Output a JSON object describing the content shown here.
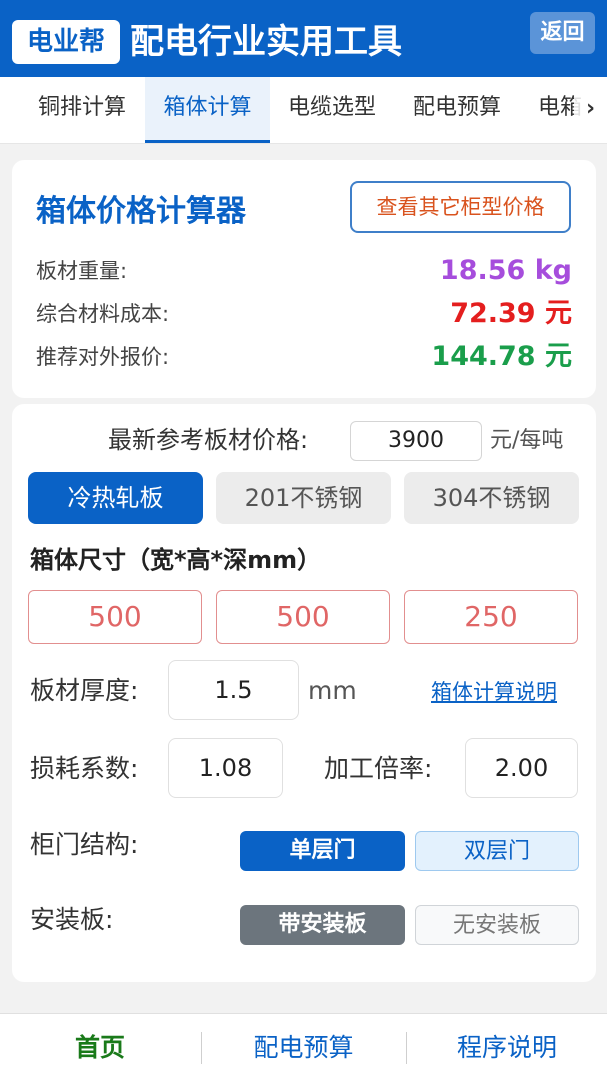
{
  "header": {
    "logo": "电业帮",
    "title": "配电行业实用工具",
    "back_label": "返回"
  },
  "tabs": [
    {
      "label": "铜排计算"
    },
    {
      "label": "箱体计算",
      "active": true
    },
    {
      "label": "电缆选型"
    },
    {
      "label": "配电预算"
    },
    {
      "label": "电箱"
    }
  ],
  "calculator": {
    "title": "箱体价格计算器",
    "other_price_button": "查看其它柜型价格",
    "results": [
      {
        "label": "板材重量:",
        "value": "18.56 kg",
        "color": "#a64ddc"
      },
      {
        "label": "综合材料成本:",
        "value": "72.39 元",
        "color": "#e41e1e"
      },
      {
        "label": "推荐对外报价:",
        "value": "144.78 元",
        "color": "#1a9e4b"
      }
    ]
  },
  "form": {
    "price_label": "最新参考板材价格:",
    "price_value": "3900",
    "price_unit": "元/每吨",
    "materials": [
      {
        "label": "冷热轧板",
        "active": true
      },
      {
        "label": "201不锈钢"
      },
      {
        "label": "304不锈钢"
      }
    ],
    "size_title": "箱体尺寸（宽*高*深mm）",
    "dims": [
      "500",
      "500",
      "250"
    ],
    "thickness_label": "板材厚度:",
    "thickness_value": "1.5",
    "thickness_unit": "mm",
    "help_link": "箱体计算说明",
    "loss_label": "损耗系数:",
    "loss_value": "1.08",
    "rate_label": "加工倍率:",
    "rate_value": "2.00",
    "door_label": "柜门结构:",
    "door_options": [
      {
        "label": "单层门",
        "active": true
      },
      {
        "label": "双层门"
      }
    ],
    "plate_label": "安装板:",
    "plate_options": [
      {
        "label": "带安装板",
        "active": true
      },
      {
        "label": "无安装板"
      }
    ]
  },
  "bottom_nav": [
    {
      "label": "首页",
      "active": true
    },
    {
      "label": "配电预算"
    },
    {
      "label": "程序说明"
    }
  ],
  "colors": {
    "primary": "#0a62c6",
    "active_nav": "#1a7a1a",
    "plate_active": "#6c757d"
  }
}
